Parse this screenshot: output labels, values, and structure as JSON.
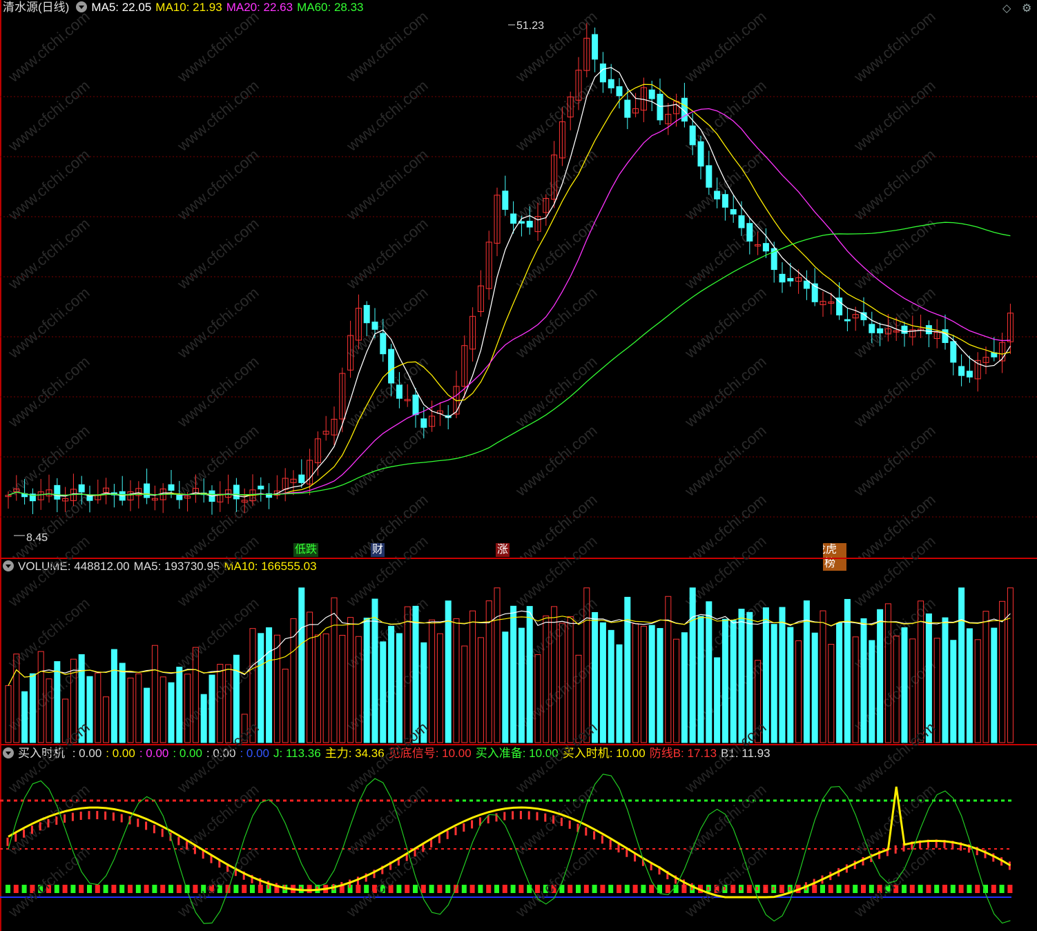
{
  "main": {
    "title": "清水源(日线)",
    "ma": [
      {
        "label": "MA5: 22.05",
        "color": "#ffffff"
      },
      {
        "label": "MA10: 21.93",
        "color": "#ffee00"
      },
      {
        "label": "MA20: 22.63",
        "color": "#ff33ff"
      },
      {
        "label": "MA60: 28.33",
        "color": "#33ff33"
      }
    ],
    "high_label": "51.23",
    "low_label": "8.45",
    "tags": [
      {
        "text": "低跌",
        "color": "#33ff33",
        "bg": "#114411"
      },
      {
        "text": "财",
        "color": "#ffffff",
        "bg": "#223366"
      },
      {
        "text": "涨",
        "color": "#ffffff",
        "bg": "#881111"
      },
      {
        "text": "龙虎榜",
        "color": "#ffffff",
        "bg": "#aa5511"
      }
    ]
  },
  "volume": {
    "label": "VOLUME: 448812.00",
    "ma5": "MA5: 193730.95",
    "ma10": "MA10: 166555.03"
  },
  "indicator": {
    "name": "买入时机",
    "vals": [
      {
        "text": ": 0.00",
        "color": "#dddddd"
      },
      {
        "text": ": 0.00",
        "color": "#ffee00"
      },
      {
        "text": ": 0.00",
        "color": "#ff33ff"
      },
      {
        "text": ": 0.00",
        "color": "#33ff33"
      },
      {
        "text": ": 0.00",
        "color": "#dddddd"
      },
      {
        "text": ": 0.00",
        "color": "#3355ff"
      },
      {
        "text": "J: 113.36",
        "color": "#33ff33"
      },
      {
        "text": "主力: 34.36",
        "color": "#ffee00"
      },
      {
        "text": "见底信号: 10.00",
        "color": "#ff3333"
      },
      {
        "text": "买入准备: 10.00",
        "color": "#33ff33"
      },
      {
        "text": "买入时机: 10.00",
        "color": "#ffee00"
      },
      {
        "text": "防线B: 17.13",
        "color": "#ff3333"
      },
      {
        "text": "B1: 11.93",
        "color": "#dddddd"
      }
    ]
  },
  "watermark": "www.cfchi.com"
}
